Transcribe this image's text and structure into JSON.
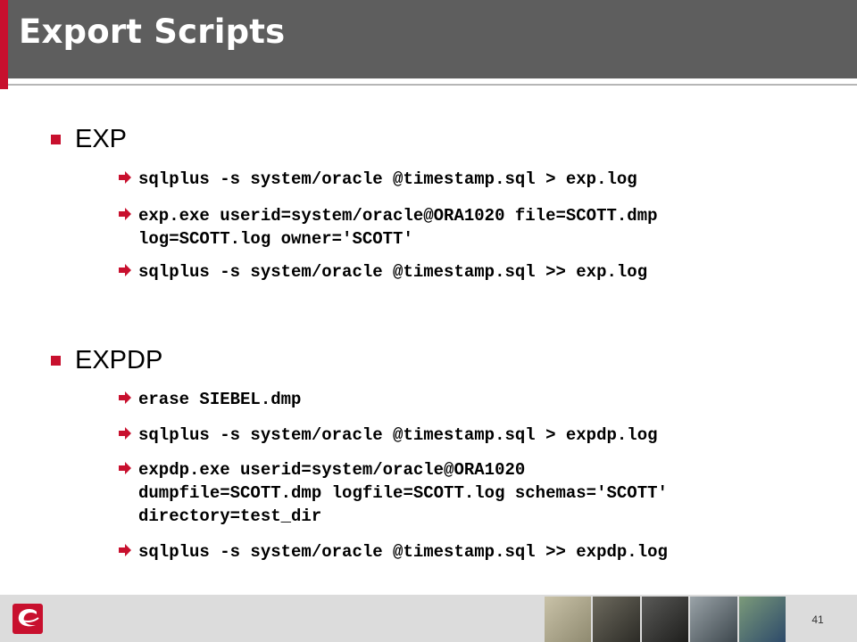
{
  "slide": {
    "title": "Export Scripts",
    "page_number": "41",
    "colors": {
      "accent": "#c8102e",
      "title_bar": "#5e5e5e",
      "footer": "#dcdcdc"
    },
    "bullet_icon": "red-square-icon",
    "sub_bullet_icon": "arrow-right-icon",
    "sections": [
      {
        "heading": "EXP",
        "commands": [
          "sqlplus -s system/oracle @timestamp.sql > exp.log",
          "exp.exe userid=system/oracle@ORA1020 file=SCOTT.dmp\nlog=SCOTT.log owner='SCOTT'",
          "sqlplus -s system/oracle @timestamp.sql >> exp.log"
        ]
      },
      {
        "heading": "EXPDP",
        "commands": [
          "erase SIEBEL.dmp",
          "sqlplus -s system/oracle @timestamp.sql > expdp.log",
          "expdp.exe userid=system/oracle@ORA1020\ndumpfile=SCOTT.dmp logfile=SCOTT.log schemas='SCOTT'\ndirectory=test_dir",
          "sqlplus -s system/oracle @timestamp.sql >> expdp.log"
        ]
      }
    ]
  }
}
